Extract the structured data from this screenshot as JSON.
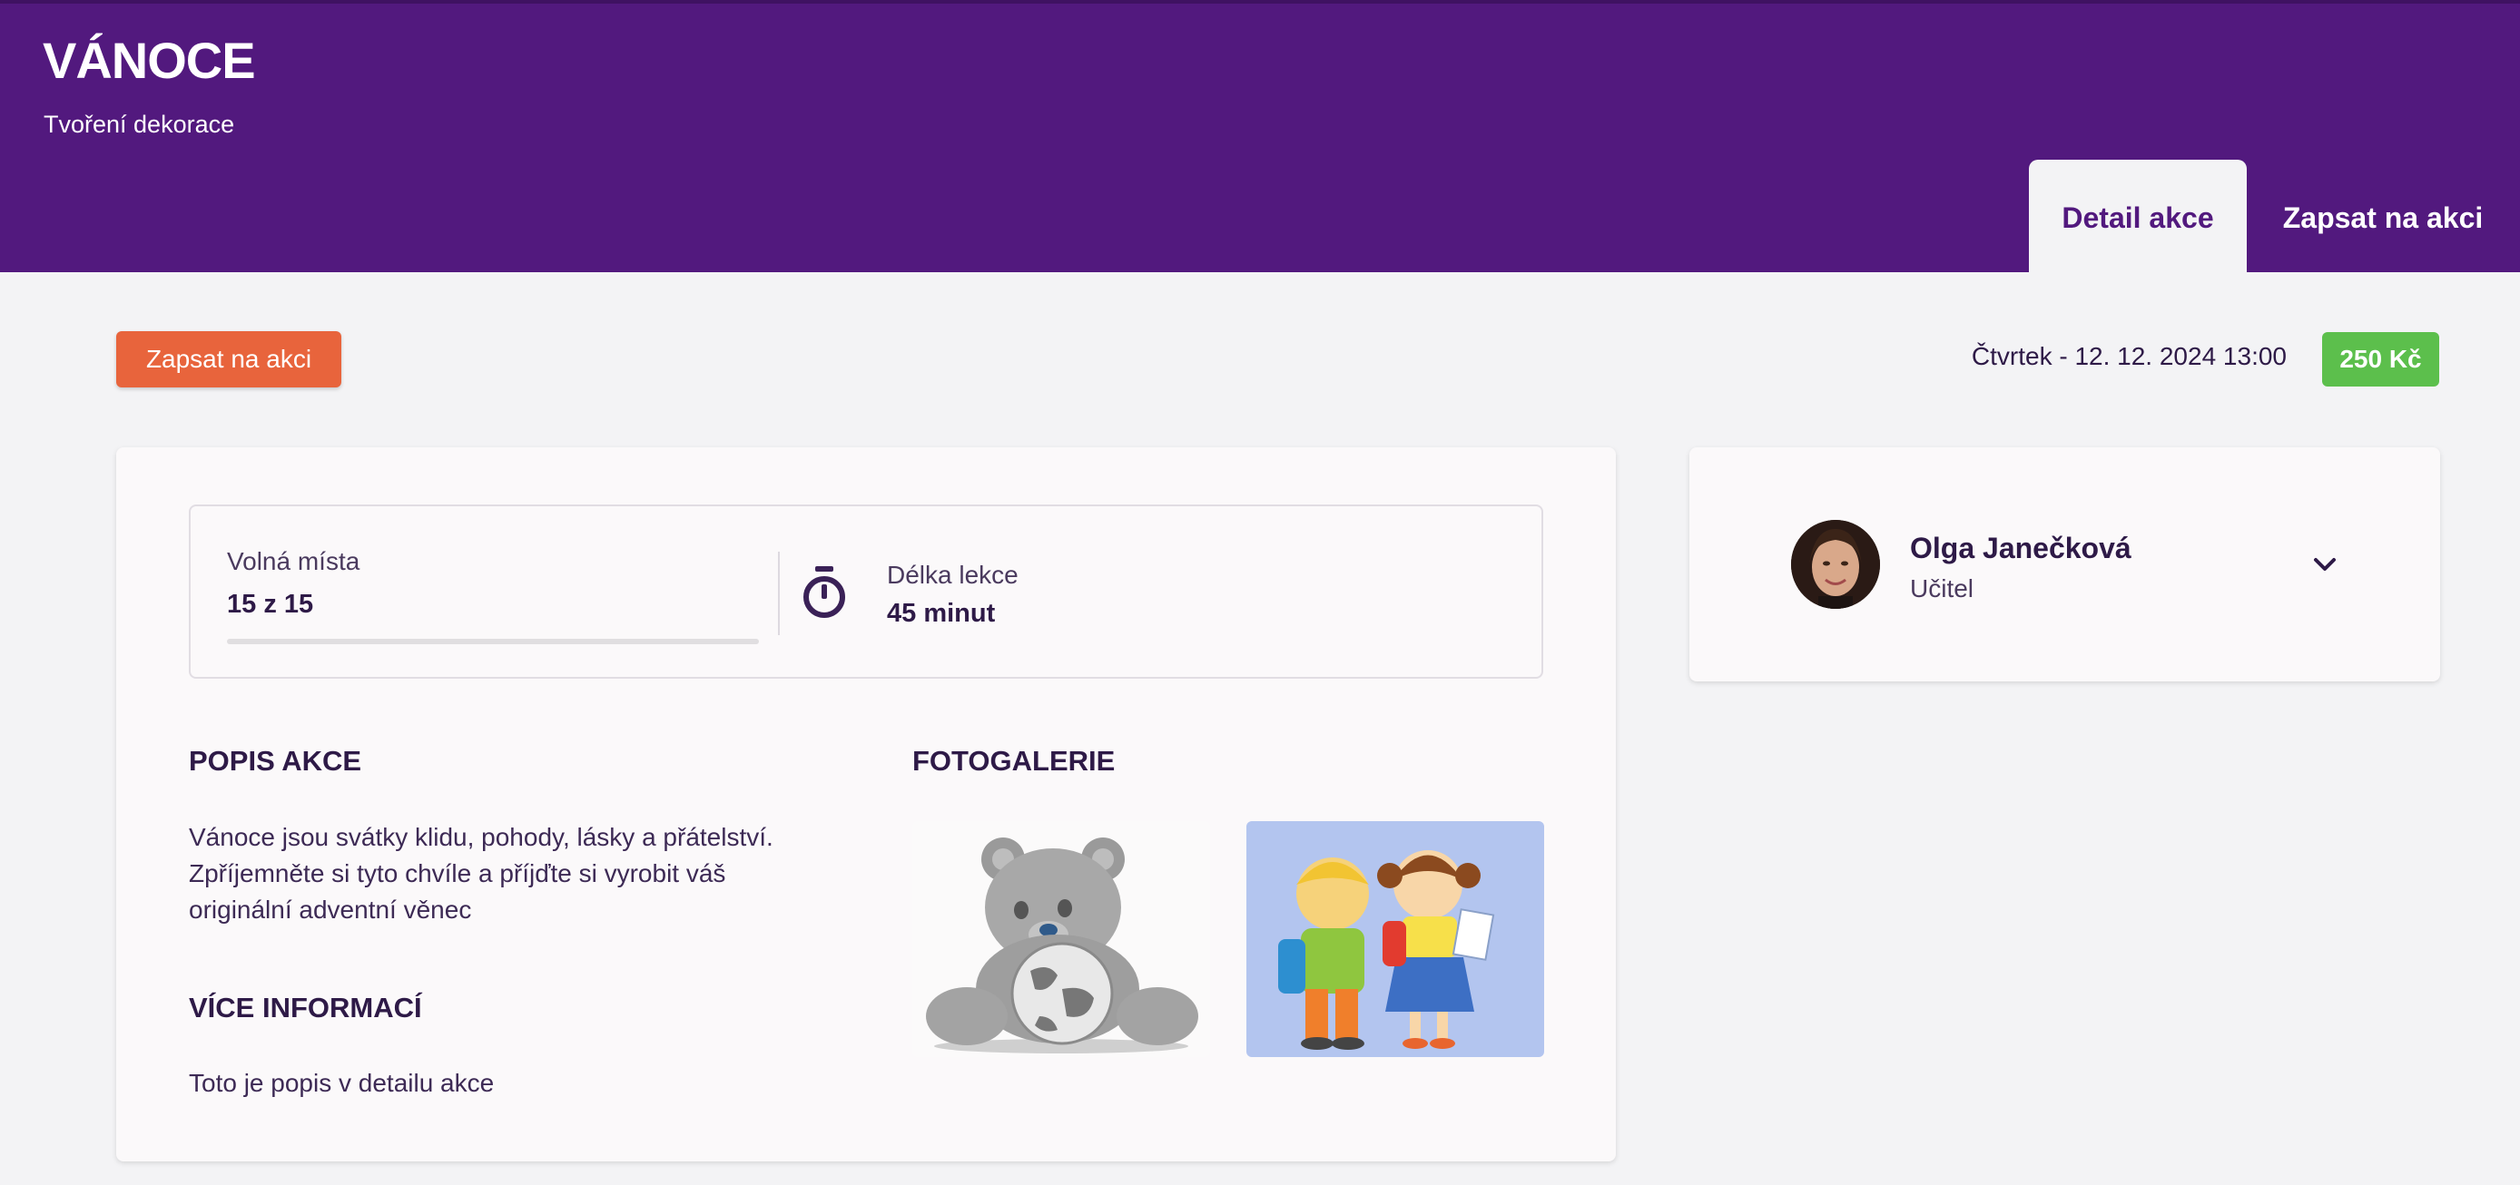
{
  "header": {
    "title": "VÁNOCE",
    "subtitle": "Tvoření dekorace",
    "tabs": [
      {
        "label": "Detail akce",
        "active": true
      },
      {
        "label": "Zapsat na akci",
        "active": false
      }
    ]
  },
  "actions": {
    "signup_label": "Zapsat na akci",
    "date": "Čtvrtek - 12. 12. 2024 13:00",
    "price": "250 Kč"
  },
  "stats": {
    "free_label": "Volná místa",
    "free_value": "15 z 15",
    "occupancy_fraction": 0,
    "duration_label": "Délka lekce",
    "duration_value": "45 minut"
  },
  "description": {
    "heading": "POPIS AKCE",
    "text": "Vánoce jsou svátky klidu, pohody, lásky a přátelství.\nZpříjemněte si tyto chvíle a příjďte si vyrobit  váš\noriginální adventní věnec"
  },
  "more_info": {
    "heading": "VÍCE INFORMACÍ",
    "text": "Toto je popis v detailu akce"
  },
  "gallery": {
    "heading": "FOTOGALERIE",
    "photos": [
      "teddy-bear-globe",
      "children-with-backpacks"
    ]
  },
  "teacher": {
    "name": "Olga Janečková",
    "role": "Učitel"
  },
  "colors": {
    "brand": "#52197e",
    "accent": "#e8643c",
    "price": "#5cbf4c"
  }
}
